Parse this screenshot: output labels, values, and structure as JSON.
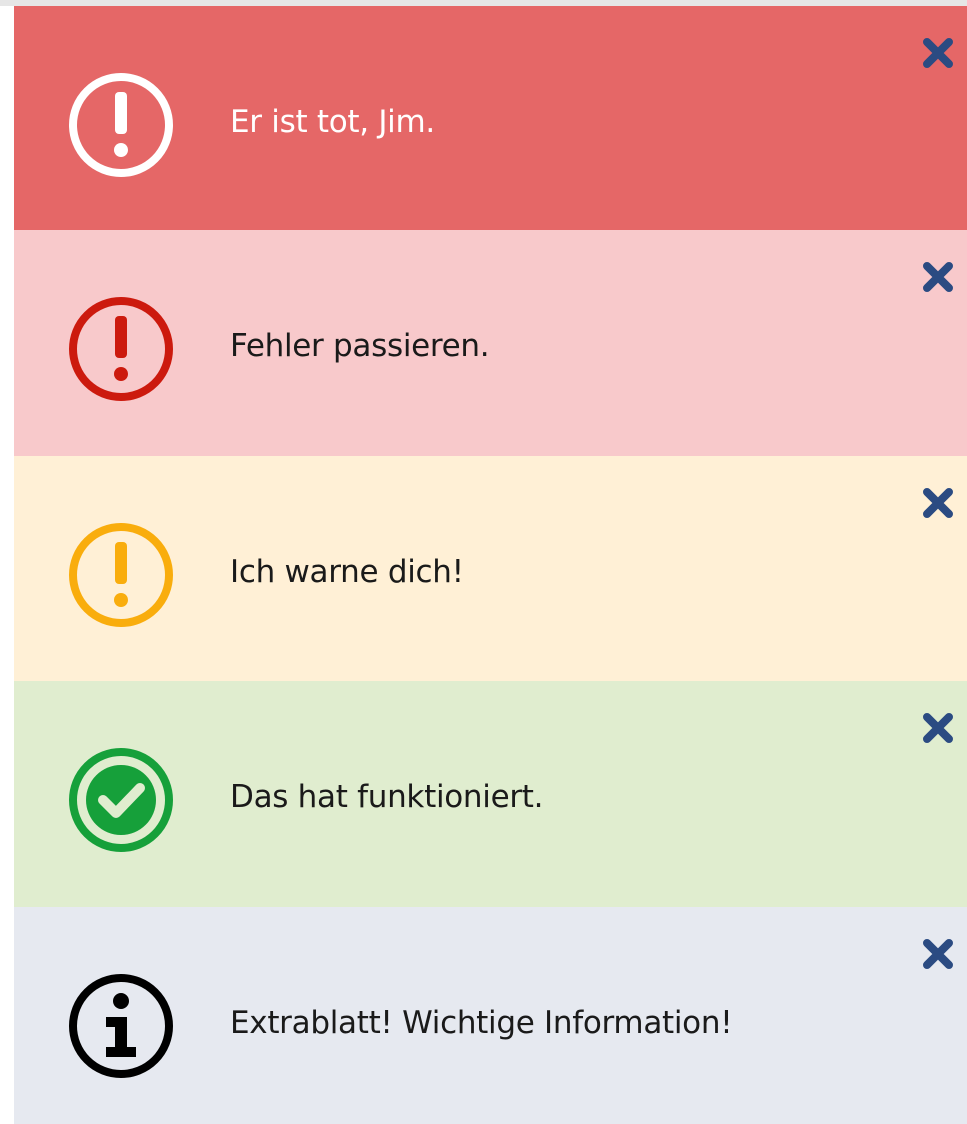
{
  "alerts": [
    {
      "type": "critical",
      "message": "Er ist tot, Jim.",
      "icon": "exclamation-circle-icon",
      "background": "#e56767",
      "icon_color": "#ffffff",
      "text_color": "#ffffff"
    },
    {
      "type": "error",
      "message": "Fehler passieren.",
      "icon": "exclamation-circle-icon",
      "background": "#f8c9cb",
      "icon_color": "#cc1a0e",
      "text_color": "#1a1a1a"
    },
    {
      "type": "warning",
      "message": "Ich warne dich!",
      "icon": "exclamation-circle-icon",
      "background": "#fff0d6",
      "icon_color": "#f9ad0d",
      "text_color": "#1a1a1a"
    },
    {
      "type": "success",
      "message": "Das hat funktioniert.",
      "icon": "check-circle-icon",
      "background": "#e0edcf",
      "icon_color": "#16a03a",
      "text_color": "#1a1a1a"
    },
    {
      "type": "info",
      "message": "Extrablatt! Wichtige Information!",
      "icon": "info-circle-icon",
      "background": "#e6e9f0",
      "icon_color": "#000000",
      "text_color": "#1a1a1a"
    }
  ],
  "close_icon": "close-icon",
  "close_color": "#2b4b82"
}
